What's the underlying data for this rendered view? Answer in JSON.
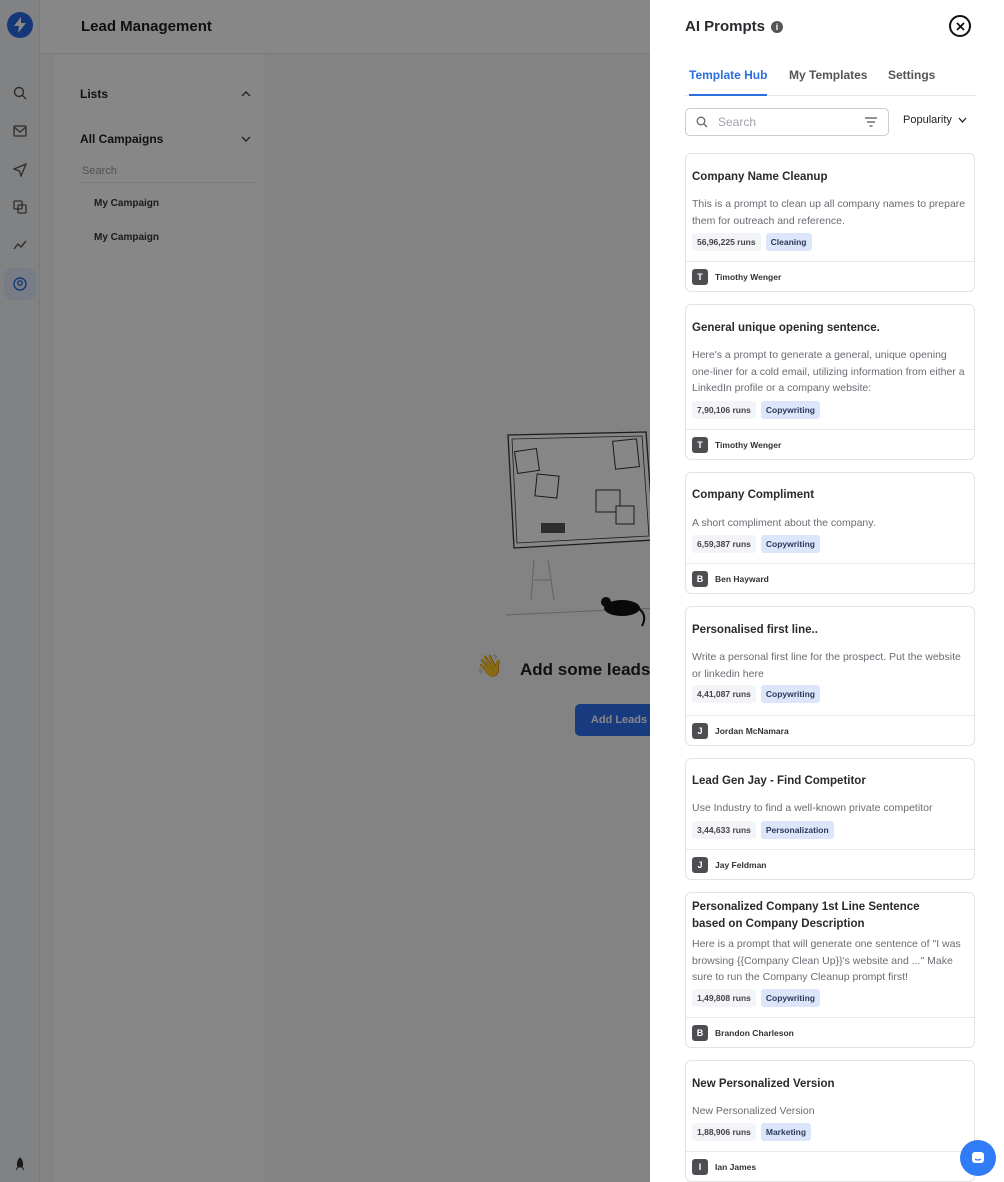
{
  "app": {
    "page_title": "Lead Management",
    "lists_label": "Lists",
    "campaigns_label": "All Campaigns",
    "campaign_search_placeholder": "Search",
    "campaigns": [
      "My Campaign",
      "My Campaign"
    ],
    "empty_state_title": "Add some leads",
    "add_leads_label": "Add Leads",
    "sidebar_icons": [
      "search-icon",
      "mail-icon",
      "send-icon",
      "copy-icon",
      "analytics-icon",
      "user-circle-icon",
      "rocket-icon"
    ]
  },
  "drawer": {
    "title": "AI Prompts",
    "tabs": [
      {
        "label": "Template Hub",
        "active": true
      },
      {
        "label": "My Templates",
        "active": false
      },
      {
        "label": "Settings",
        "active": false
      }
    ],
    "search_placeholder": "Search",
    "sort_label": "Popularity",
    "accent_color": "#2a6fe0",
    "cards": [
      {
        "title": "Company Name Cleanup",
        "description": "This is a prompt to clean up all company names to prepare them for outreach and reference.",
        "runs": "56,96,225 runs",
        "tag": "Cleaning",
        "author_initial": "T",
        "author": "Timothy Wenger"
      },
      {
        "title": "General unique opening sentence.",
        "description": "Here's a prompt to generate a general, unique opening one-liner for a cold email, utilizing information from either a LinkedIn profile or a company website:",
        "runs": "7,90,106 runs",
        "tag": "Copywriting",
        "author_initial": "T",
        "author": "Timothy Wenger"
      },
      {
        "title": "Company Compliment",
        "description": "A short compliment about the company.",
        "runs": "6,59,387 runs",
        "tag": "Copywriting",
        "author_initial": "B",
        "author": "Ben Hayward"
      },
      {
        "title": "Personalised first line..",
        "description": "Write a personal first line for the prospect. Put the website or linkedin here",
        "runs": "4,41,087 runs",
        "tag": "Copywriting",
        "author_initial": "J",
        "author": "Jordan McNamara"
      },
      {
        "title": "Lead Gen Jay - Find Competitor",
        "description": "Use Industry to find a well-known private competitor",
        "runs": "3,44,633 runs",
        "tag": "Personalization",
        "author_initial": "J",
        "author": "Jay Feldman"
      },
      {
        "title": "Personalized Company 1st Line Sentence based on Company Description",
        "description": "Here is a prompt that will generate one sentence of \"I was browsing {{Company Clean Up}}'s website and ...\" Make sure to run the Company Cleanup prompt first!",
        "runs": "1,49,808 runs",
        "tag": "Copywriting",
        "author_initial": "B",
        "author": "Brandon Charleson"
      },
      {
        "title": "New Personalized Version",
        "description": "New Personalized Version",
        "runs": "1,88,906 runs",
        "tag": "Marketing",
        "author_initial": "I",
        "author": "Ian James"
      }
    ]
  }
}
